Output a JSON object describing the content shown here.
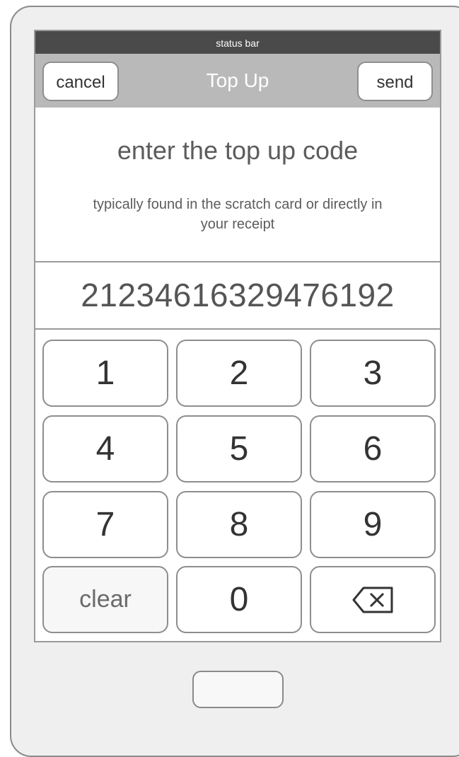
{
  "status_bar": {
    "label": "status bar"
  },
  "nav": {
    "title": "Top Up",
    "cancel_label": "cancel",
    "send_label": "send"
  },
  "prompt": {
    "heading": "enter the top up code",
    "subtext": "typically found in the scratch card or directly in your receipt"
  },
  "code": {
    "value": "21234616329476192"
  },
  "keypad": {
    "keys": [
      "1",
      "2",
      "3",
      "4",
      "5",
      "6",
      "7",
      "8",
      "9",
      "clear",
      "0"
    ],
    "backspace_icon": "backspace-icon"
  }
}
